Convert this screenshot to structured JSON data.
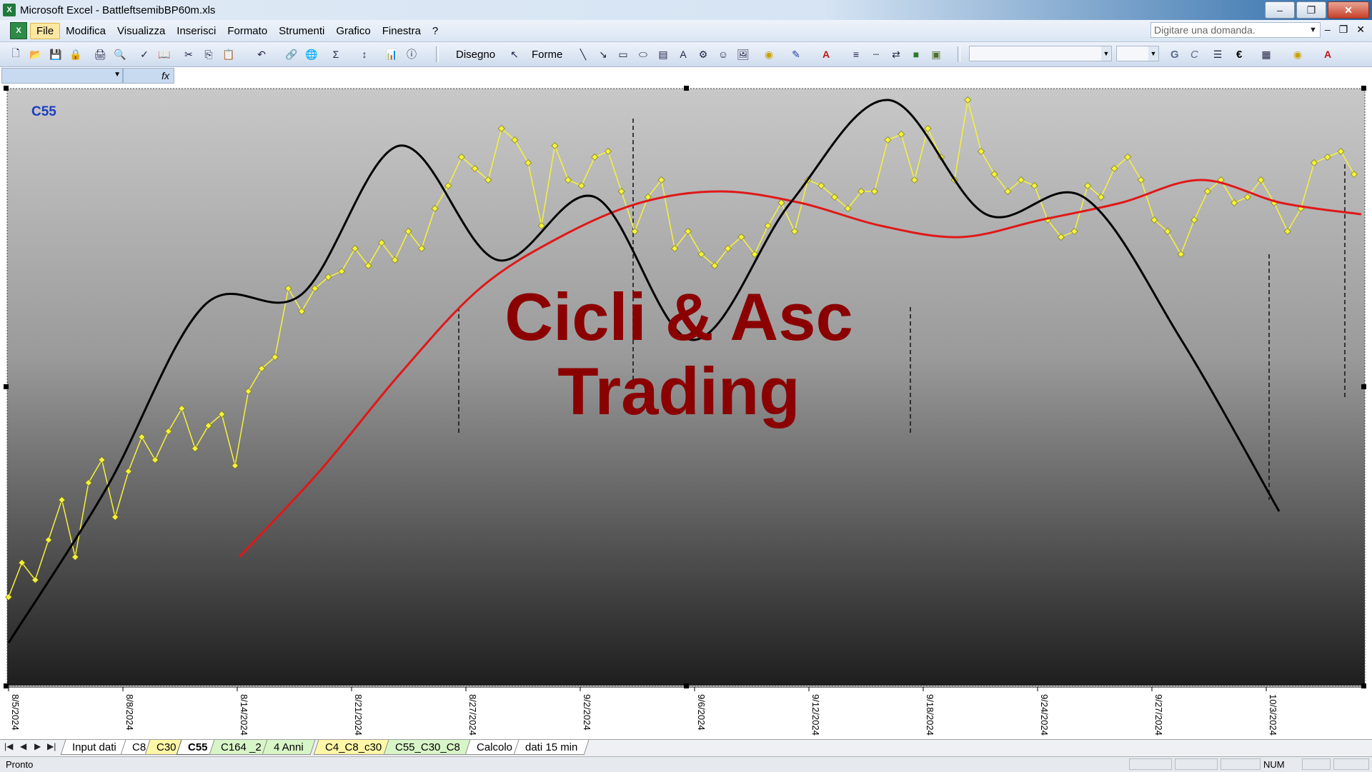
{
  "window": {
    "title": "Microsoft Excel - BattleftsemibBP60m.xls",
    "app_icon": "excel-icon"
  },
  "menu": {
    "items": [
      "File",
      "Modifica",
      "Visualizza",
      "Inserisci",
      "Formato",
      "Strumenti",
      "Grafico",
      "Finestra",
      "?"
    ],
    "help_placeholder": "Digitare una domanda."
  },
  "toolbar": {
    "disegno_label": "Disegno",
    "forme_label": "Forme",
    "bold_label": "G",
    "italic_label": "C",
    "euro_label": "€"
  },
  "formula_bar": {
    "fx_label": "fx"
  },
  "chart": {
    "sheet_label": "C55",
    "watermark_line1": "Cicli & Asc",
    "watermark_line2": "Trading",
    "colors": {
      "price": "#f5f23a",
      "ma": "#e01818",
      "cycle": "#000000",
      "watermark": "#8b0000",
      "label": "#1a3fc0"
    }
  },
  "chart_data": {
    "type": "line",
    "x_tick_labels": [
      "8/5/2024",
      "8/8/2024",
      "8/14/2024",
      "8/21/2024",
      "8/27/2024",
      "9/2/2024",
      "9/6/2024",
      "9/12/2024",
      "9/18/2024",
      "9/24/2024",
      "9/27/2024",
      "10/3/2024"
    ],
    "grid": false,
    "legend": "none",
    "series": [
      {
        "style": "yellow diamond markers",
        "values": [
          0.13,
          0.19,
          0.16,
          0.23,
          0.3,
          0.2,
          0.33,
          0.37,
          0.27,
          0.35,
          0.41,
          0.37,
          0.42,
          0.46,
          0.39,
          0.43,
          0.45,
          0.36,
          0.49,
          0.53,
          0.55,
          0.67,
          0.63,
          0.67,
          0.69,
          0.7,
          0.74,
          0.71,
          0.75,
          0.72,
          0.77,
          0.74,
          0.81,
          0.85,
          0.9,
          0.88,
          0.86,
          0.95,
          0.93,
          0.89,
          0.78,
          0.92,
          0.86,
          0.85,
          0.9,
          0.91,
          0.84,
          0.77,
          0.83,
          0.86,
          0.74,
          0.77,
          0.73,
          0.71,
          0.74,
          0.76,
          0.73,
          0.78,
          0.82,
          0.77,
          0.86,
          0.85,
          0.83,
          0.81,
          0.84,
          0.84,
          0.93,
          0.94,
          0.86,
          0.95,
          0.9,
          0.86,
          1.0,
          0.91,
          0.87,
          0.84,
          0.86,
          0.85,
          0.79,
          0.76,
          0.77,
          0.85,
          0.83,
          0.88,
          0.9,
          0.86,
          0.79,
          0.77,
          0.73,
          0.79,
          0.84,
          0.86,
          0.82,
          0.83,
          0.86,
          0.82,
          0.77,
          0.81,
          0.89,
          0.9,
          0.91,
          0.87
        ]
      },
      {
        "style": "red line",
        "values": [
          0.2,
          0.35,
          0.52,
          0.67,
          0.76,
          0.82,
          0.84,
          0.82,
          0.78,
          0.76,
          0.79,
          0.82,
          0.86,
          0.82,
          0.8
        ]
      },
      {
        "style": "black line",
        "values": [
          0.05,
          0.32,
          0.64,
          0.66,
          0.92,
          0.72,
          0.83,
          0.58,
          0.82,
          1.0,
          0.8,
          0.83,
          0.58,
          0.28
        ]
      }
    ]
  },
  "sheet_tabs": {
    "nav": [
      "|◀",
      "◀",
      "▶",
      "▶|"
    ],
    "tabs": [
      {
        "label": "Input dati",
        "color": "white"
      },
      {
        "label": "C8",
        "color": "white"
      },
      {
        "label": "C30",
        "color": "yellow"
      },
      {
        "label": "C55",
        "color": "active"
      },
      {
        "label": "C164 _2",
        "color": "green"
      },
      {
        "label": "4 Anni",
        "color": "green"
      },
      {
        "label": "C4_C8_c30",
        "color": "yellow"
      },
      {
        "label": "C55_C30_C8",
        "color": "green"
      },
      {
        "label": "Calcolo",
        "color": "white"
      },
      {
        "label": "dati 15 min",
        "color": "white"
      }
    ]
  },
  "status": {
    "text": "Pronto",
    "num": "NUM"
  }
}
